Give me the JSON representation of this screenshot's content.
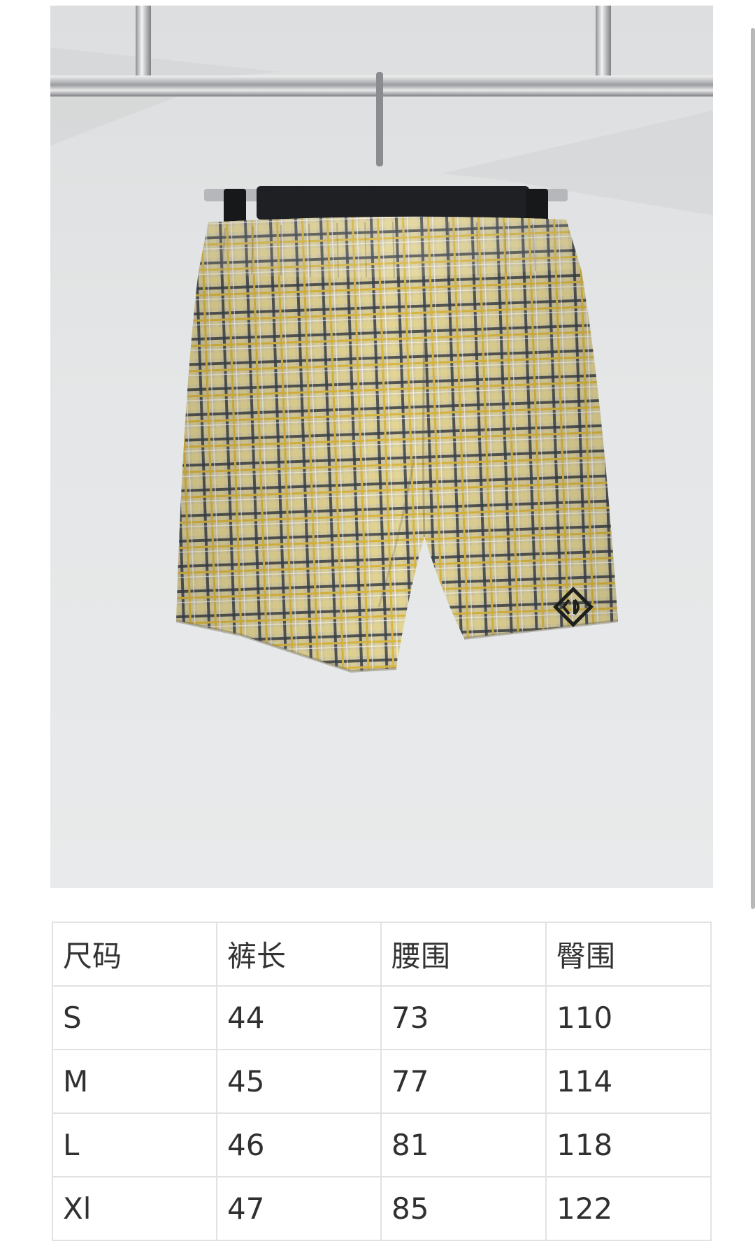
{
  "colors": {
    "background": "#ffffff",
    "wall": "#e2e4e5",
    "plaid_base": "#cfc7a6",
    "plaid_yellow": "#d8b640",
    "plaid_dark": "#3b3f45",
    "table_border": "#e2e2e2",
    "text": "#303030"
  },
  "photo": {
    "subject": "plaid-shorts-on-hanger"
  },
  "size_table": {
    "headers": [
      "尺码",
      "裤长",
      "腰围",
      "臀围"
    ],
    "rows": [
      [
        "S",
        "44",
        "73",
        "110"
      ],
      [
        "M",
        "45",
        "77",
        "114"
      ],
      [
        "L",
        "46",
        "81",
        "118"
      ],
      [
        "Xl",
        "47",
        "85",
        "122"
      ]
    ]
  }
}
